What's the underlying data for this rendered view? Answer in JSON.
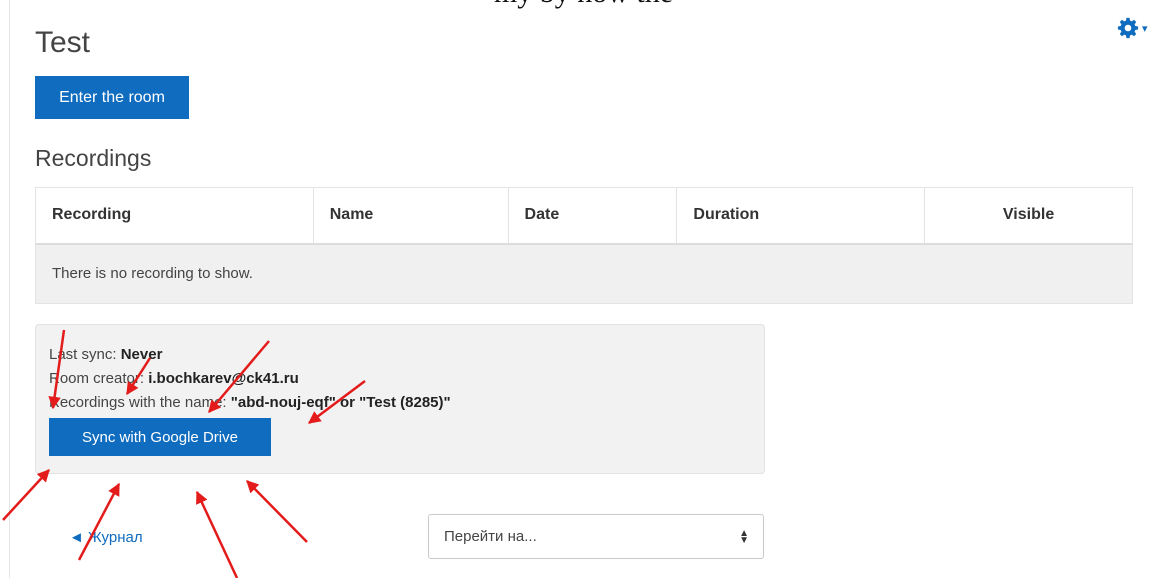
{
  "page": {
    "cropped_text": "my by now the"
  },
  "settings": {
    "icon": "gear-icon",
    "caret": "▾"
  },
  "activity": {
    "title": "Test",
    "enter_button": "Enter the room"
  },
  "recordings": {
    "heading": "Recordings",
    "columns": [
      "Recording",
      "Name",
      "Date",
      "Duration",
      "Visible"
    ],
    "empty_message": "There is no recording to show."
  },
  "sync_panel": {
    "last_sync_label": "Last sync:",
    "last_sync_value": "Never",
    "creator_label": "Room creator:",
    "creator_value": "i.bochkarev@ck41.ru",
    "name_label": "Recordings with the name:",
    "name_value": "\"abd-nouj-eqf\" or \"Test (8285)\"",
    "sync_button": "Sync with Google Drive"
  },
  "footer": {
    "journal_arrow": "◄",
    "journal_link": "Журнал",
    "jump_placeholder": "Перейти на..."
  },
  "colors": {
    "primary": "#0f6cbf",
    "annotation_arrows": "#e31b1b"
  }
}
